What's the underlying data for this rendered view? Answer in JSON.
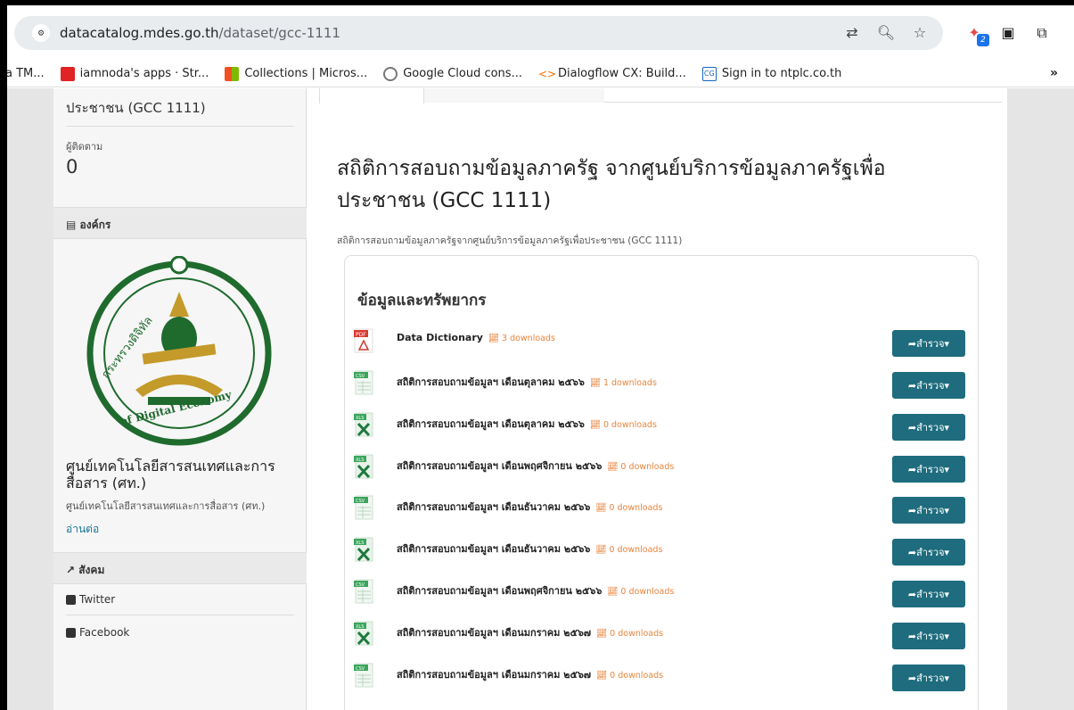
{
  "browser": {
    "url_domain": "datacatalog.mdes.go.th",
    "url_path": "/dataset/gcc-1111",
    "extension_badge": "2"
  },
  "bookmarks": [
    {
      "label": "a TM...",
      "color": ""
    },
    {
      "label": "iamnoda's apps · Str...",
      "color": "#e02424"
    },
    {
      "label": "Collections | Micros...",
      "color": "#f25022"
    },
    {
      "label": "Google Cloud cons...",
      "color": "#777777"
    },
    {
      "label": "Dialogflow CX: Build...",
      "color": "#ff6f00"
    },
    {
      "label": "Sign in to ntplc.co.th",
      "color": "#1565c0"
    }
  ],
  "bookmarks_more": "»",
  "sidebar": {
    "title_fragment": "ประชาชน (GCC 1111)",
    "followers_label": "ผู้ติดตาม",
    "followers_count": "0",
    "org_heading": "องค์กร",
    "org_name": "ศูนย์เทคโนโลยีสารสนเทศและการสื่อสาร (ศท.)",
    "org_sub": "ศูนย์เทคโนโลยีสารสนเทศและการสื่อสาร (ศท.)",
    "read_more": "อ่านต่อ",
    "social_heading": "สังคม",
    "twitter": "Twitter",
    "facebook": "Facebook",
    "logo_text_top": "กระทรวงดิจิทัลเพื่อเศรษฐกิจและสังคม",
    "logo_text_bottom": "Ministry of Digital Economy and Society"
  },
  "main": {
    "title": "สถิติการสอบถามข้อมูลภาครัฐ จากศูนย์บริการข้อมูลภาครัฐเพื่อประชาชน (GCC 1111)",
    "description": "สถิติการสอบถามข้อมูลภาครัฐจากศูนย์บริการข้อมูลภาครัฐเพื่อประชาชน (GCC 1111)",
    "resources_heading": "ข้อมูลและทรัพยากร",
    "explore_label": "สำรวจ",
    "resources": [
      {
        "name": "Data Dictionary",
        "downloads": "3 downloads",
        "format": "PDF"
      },
      {
        "name": "สถิติการสอบถามข้อมูลฯ เดือนตุลาคม ๒๕๖๖",
        "downloads": "1 downloads",
        "format": "CSV"
      },
      {
        "name": "สถิติการสอบถามข้อมูลฯ เดือนตุลาคม ๒๕๖๖",
        "downloads": "0 downloads",
        "format": "XLS"
      },
      {
        "name": "สถิติการสอบถามข้อมูลฯ เดือนพฤศจิกายน ๒๕๖๖",
        "downloads": "0 downloads",
        "format": "XLS"
      },
      {
        "name": "สถิติการสอบถามข้อมูลฯ เดือนธันวาคม ๒๕๖๖",
        "downloads": "0 downloads",
        "format": "CSV"
      },
      {
        "name": "สถิติการสอบถามข้อมูลฯ เดือนธันวาคม ๒๕๖๖",
        "downloads": "0 downloads",
        "format": "XLS"
      },
      {
        "name": "สถิติการสอบถามข้อมูลฯ เดือนพฤศจิกายน ๒๕๖๖",
        "downloads": "0 downloads",
        "format": "CSV"
      },
      {
        "name": "สถิติการสอบถามข้อมูลฯ เดือนมกราคม ๒๕๖๗",
        "downloads": "0 downloads",
        "format": "XLS"
      },
      {
        "name": "สถิติการสอบถามข้อมูลฯ เดือนมกราคม ๒๕๖๗",
        "downloads": "0 downloads",
        "format": "CSV"
      }
    ]
  },
  "colors": {
    "accent": "#1e6c7e",
    "download_text": "#e8853d",
    "link": "#187794",
    "logo_green": "#1f6b2e",
    "logo_gold": "#c49a2a"
  }
}
